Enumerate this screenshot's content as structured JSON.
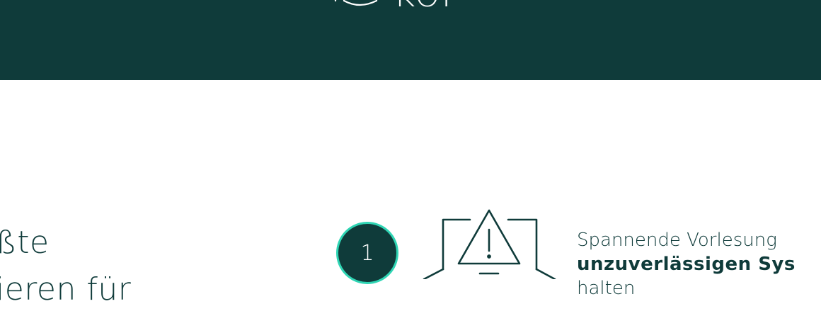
{
  "header": {
    "logo_text": "KOI",
    "background_color": "#0f3b3a",
    "logo_icon": "graduation-cap-icon"
  },
  "headline": {
    "line1": "ßte",
    "line2": "ieren für"
  },
  "step": {
    "number": "1",
    "circle_border_color": "#2fd5b4",
    "illustration_icon": "laptop-warning-icon",
    "text_line1": "Spannende Vorlesung",
    "text_line2_bold": "unzuverlässigen Sys",
    "text_line3": "halten"
  }
}
